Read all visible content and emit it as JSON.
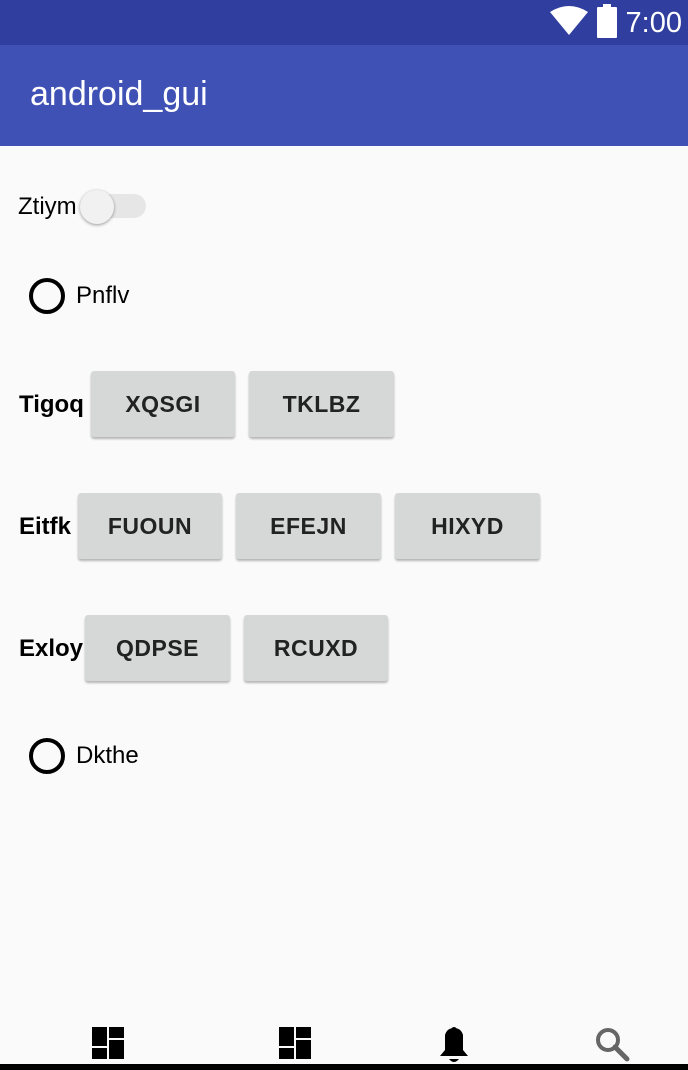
{
  "status_bar": {
    "time": "7:00",
    "icons": [
      "wifi-icon",
      "battery-icon"
    ],
    "color": "#303f9f"
  },
  "app_bar": {
    "title": "android_gui",
    "color": "#3f51b5"
  },
  "switch_row": {
    "label": "Ztiym",
    "checked": false
  },
  "radio1": {
    "label": "Pnflv",
    "checked": false
  },
  "row_tigoq": {
    "label": "Tigoq",
    "buttons": [
      "XQSGI",
      "TKLBZ"
    ]
  },
  "row_eitfk": {
    "label": "Eitfk",
    "buttons": [
      "FUOUN",
      "EFEJN",
      "HIXYD"
    ]
  },
  "row_exloy": {
    "label": "Exloy",
    "buttons": [
      "QDPSE",
      "RCUXD"
    ]
  },
  "radio2": {
    "label": "Dkthe",
    "checked": false
  },
  "bottom_nav": {
    "items": [
      "dashboard-icon",
      "dashboard-icon",
      "notifications-icon",
      "search-icon"
    ]
  }
}
